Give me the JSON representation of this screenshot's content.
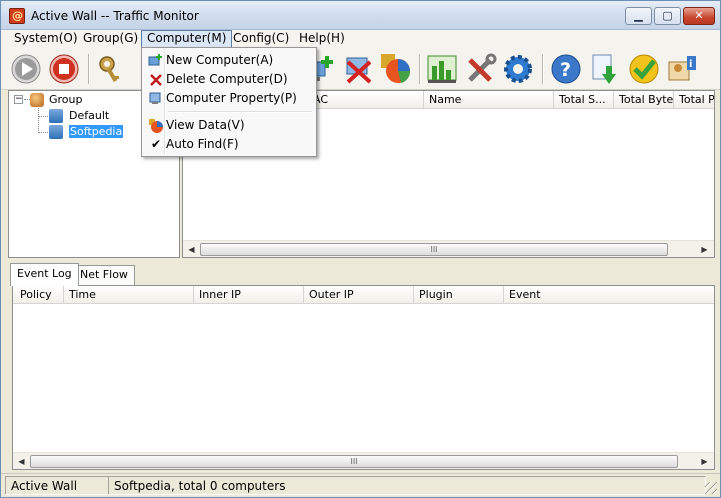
{
  "window": {
    "title": "Active Wall -- Traffic Monitor",
    "min_glyph": "▁",
    "max_glyph": "▢",
    "close_glyph": "✕"
  },
  "menubar": {
    "items": [
      {
        "label": "System(O)"
      },
      {
        "label": "Group(G)"
      },
      {
        "label": "Computer(M)"
      },
      {
        "label": "Config(C)"
      },
      {
        "label": "Help(H)"
      }
    ]
  },
  "computer_menu": {
    "items": [
      {
        "label": "New Computer(A)",
        "icon": "new-computer-icon"
      },
      {
        "label": "Delete Computer(D)",
        "icon": "delete-computer-icon"
      },
      {
        "label": "Computer Property(P)",
        "icon": "computer-property-icon"
      },
      {
        "label": "View Data(V)",
        "icon": "view-data-icon"
      },
      {
        "label": "Auto Find(F)",
        "icon": "check-icon",
        "checked": true
      }
    ],
    "check_glyph": "✔"
  },
  "toolbar": {
    "buttons": [
      {
        "icon": "play-icon"
      },
      {
        "icon": "stop-icon"
      },
      {
        "icon": "key-icon"
      },
      {
        "icon": "add-computer-icon"
      },
      {
        "icon": "delete-computer-icon"
      },
      {
        "icon": "pie-chart-icon"
      },
      {
        "icon": "bar-chart-icon"
      },
      {
        "icon": "tools-icon"
      },
      {
        "icon": "gear-icon"
      },
      {
        "icon": "help-icon"
      },
      {
        "icon": "download-icon"
      },
      {
        "icon": "checkmark-icon"
      },
      {
        "icon": "person-info-icon"
      }
    ]
  },
  "tree": {
    "expander": "−",
    "root": "Group",
    "children": [
      "Default",
      "Softpedia"
    ],
    "selected": "Softpedia"
  },
  "computer_list": {
    "columns": [
      "AC",
      "Name",
      "Total S...",
      "Total Byte",
      "Total P"
    ]
  },
  "scrollbar": {
    "left_arrow": "◀",
    "right_arrow": "▶",
    "thumb_grip": "III"
  },
  "tabs": [
    {
      "label": "Event Log",
      "active": true
    },
    {
      "label": "Net Flow",
      "active": false
    }
  ],
  "event_list": {
    "columns": [
      "Policy",
      "Time",
      "Inner IP",
      "Outer IP",
      "Plugin",
      "Event"
    ]
  },
  "statusbar": {
    "app": "Active Wall",
    "info": "Softpedia, total 0 computers"
  },
  "colors": {
    "selection": "#3399ff",
    "menu_highlight": "#dbe7f6",
    "close_button": "#c7452f"
  }
}
